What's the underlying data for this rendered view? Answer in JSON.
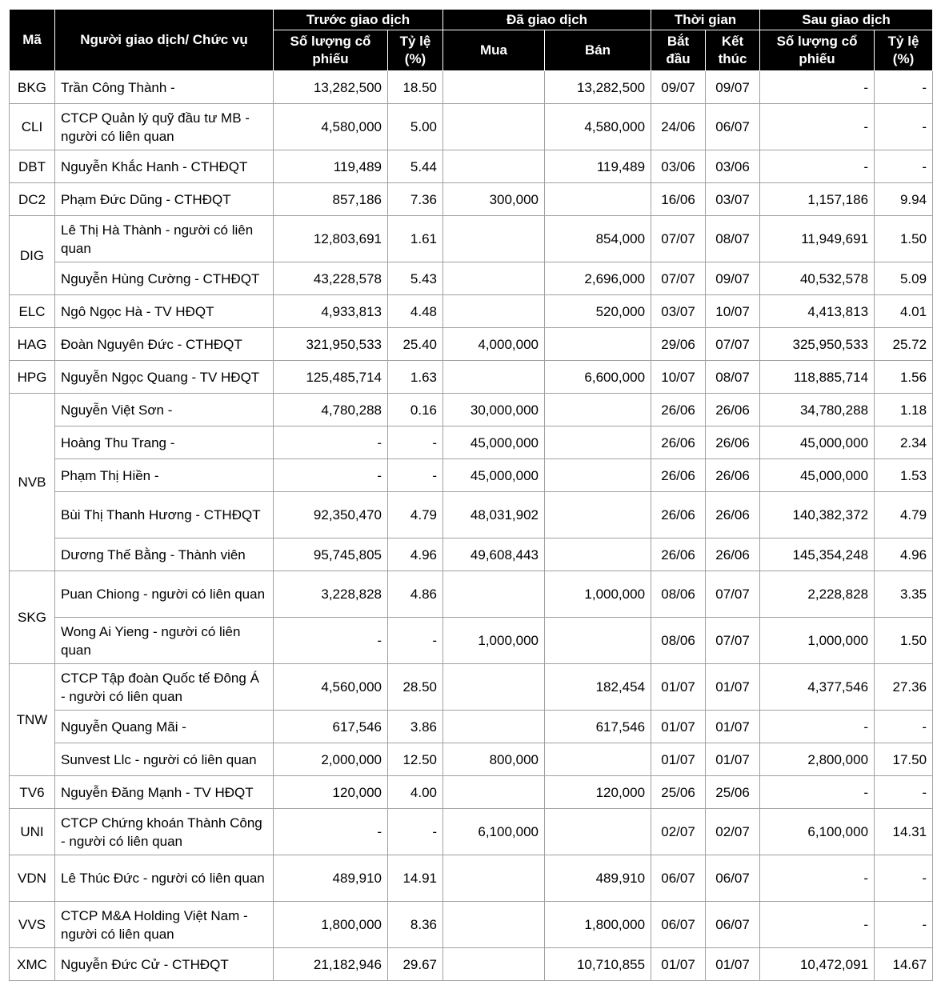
{
  "headers": {
    "ma": "Mã",
    "person": "Người giao dịch/ Chức vụ",
    "before": "Trước giao dịch",
    "traded": "Đã giao dịch",
    "time": "Thời gian",
    "after": "Sau giao dịch",
    "shares": "Số lượng cổ phiếu",
    "ratio": "Tỷ lệ (%)",
    "buy": "Mua",
    "sell": "Bán",
    "start": "Bắt đầu",
    "end": "Kết thúc"
  },
  "rows": [
    {
      "code": "BKG",
      "span": 1,
      "tall": false,
      "name": "Trần Công Thành -",
      "before_shares": "13,282,500",
      "before_ratio": "18.50",
      "buy": "",
      "sell": "13,282,500",
      "start": "09/07",
      "end": "09/07",
      "after_shares": "-",
      "after_ratio": "-"
    },
    {
      "code": "CLI",
      "span": 1,
      "tall": true,
      "name": "CTCP Quản lý quỹ đầu tư MB - người có liên quan",
      "before_shares": "4,580,000",
      "before_ratio": "5.00",
      "buy": "",
      "sell": "4,580,000",
      "start": "24/06",
      "end": "06/07",
      "after_shares": "-",
      "after_ratio": "-"
    },
    {
      "code": "DBT",
      "span": 1,
      "tall": false,
      "name": "Nguyễn Khắc Hanh - CTHĐQT",
      "before_shares": "119,489",
      "before_ratio": "5.44",
      "buy": "",
      "sell": "119,489",
      "start": "03/06",
      "end": "03/06",
      "after_shares": "-",
      "after_ratio": "-"
    },
    {
      "code": "DC2",
      "span": 1,
      "tall": false,
      "name": "Phạm Đức Dũng - CTHĐQT",
      "before_shares": "857,186",
      "before_ratio": "7.36",
      "buy": "300,000",
      "sell": "",
      "start": "16/06",
      "end": "03/07",
      "after_shares": "1,157,186",
      "after_ratio": "9.94"
    },
    {
      "code": "DIG",
      "span": 2,
      "tall": true,
      "name": "Lê Thị Hà Thành - người có liên quan",
      "before_shares": "12,803,691",
      "before_ratio": "1.61",
      "buy": "",
      "sell": "854,000",
      "start": "07/07",
      "end": "08/07",
      "after_shares": "11,949,691",
      "after_ratio": "1.50"
    },
    {
      "code": null,
      "span": 0,
      "tall": false,
      "name": "Nguyễn Hùng Cường - CTHĐQT",
      "before_shares": "43,228,578",
      "before_ratio": "5.43",
      "buy": "",
      "sell": "2,696,000",
      "start": "07/07",
      "end": "09/07",
      "after_shares": "40,532,578",
      "after_ratio": "5.09"
    },
    {
      "code": "ELC",
      "span": 1,
      "tall": false,
      "name": "Ngô Ngọc Hà - TV HĐQT",
      "before_shares": "4,933,813",
      "before_ratio": "4.48",
      "buy": "",
      "sell": "520,000",
      "start": "03/07",
      "end": "10/07",
      "after_shares": "4,413,813",
      "after_ratio": "4.01"
    },
    {
      "code": "HAG",
      "span": 1,
      "tall": false,
      "name": "Đoàn Nguyên Đức - CTHĐQT",
      "before_shares": "321,950,533",
      "before_ratio": "25.40",
      "buy": "4,000,000",
      "sell": "",
      "start": "29/06",
      "end": "07/07",
      "after_shares": "325,950,533",
      "after_ratio": "25.72"
    },
    {
      "code": "HPG",
      "span": 1,
      "tall": false,
      "name": "Nguyễn Ngọc Quang - TV HĐQT",
      "before_shares": "125,485,714",
      "before_ratio": "1.63",
      "buy": "",
      "sell": "6,600,000",
      "start": "10/07",
      "end": "08/07",
      "after_shares": "118,885,714",
      "after_ratio": "1.56"
    },
    {
      "code": "NVB",
      "span": 5,
      "tall": false,
      "name": "Nguyễn Việt Sơn -",
      "before_shares": "4,780,288",
      "before_ratio": "0.16",
      "buy": "30,000,000",
      "sell": "",
      "start": "26/06",
      "end": "26/06",
      "after_shares": "34,780,288",
      "after_ratio": "1.18"
    },
    {
      "code": null,
      "span": 0,
      "tall": false,
      "name": "Hoàng Thu Trang -",
      "before_shares": "-",
      "before_ratio": "-",
      "buy": "45,000,000",
      "sell": "",
      "start": "26/06",
      "end": "26/06",
      "after_shares": "45,000,000",
      "after_ratio": "2.34"
    },
    {
      "code": null,
      "span": 0,
      "tall": false,
      "name": "Phạm Thị Hiền -",
      "before_shares": "-",
      "before_ratio": "-",
      "buy": "45,000,000",
      "sell": "",
      "start": "26/06",
      "end": "26/06",
      "after_shares": "45,000,000",
      "after_ratio": "1.53"
    },
    {
      "code": null,
      "span": 0,
      "tall": true,
      "name": "Bùi Thị Thanh Hương - CTHĐQT",
      "before_shares": "92,350,470",
      "before_ratio": "4.79",
      "buy": "48,031,902",
      "sell": "",
      "start": "26/06",
      "end": "26/06",
      "after_shares": "140,382,372",
      "after_ratio": "4.79"
    },
    {
      "code": null,
      "span": 0,
      "tall": false,
      "name": "Dương Thế Bằng - Thành viên",
      "before_shares": "95,745,805",
      "before_ratio": "4.96",
      "buy": "49,608,443",
      "sell": "",
      "start": "26/06",
      "end": "26/06",
      "after_shares": "145,354,248",
      "after_ratio": "4.96"
    },
    {
      "code": "SKG",
      "span": 2,
      "tall": true,
      "name": "Puan Chiong - người có liên quan",
      "before_shares": "3,228,828",
      "before_ratio": "4.86",
      "buy": "",
      "sell": "1,000,000",
      "start": "08/06",
      "end": "07/07",
      "after_shares": "2,228,828",
      "after_ratio": "3.35"
    },
    {
      "code": null,
      "span": 0,
      "tall": true,
      "name": "Wong Ai Yieng - người có liên quan",
      "before_shares": "-",
      "before_ratio": "-",
      "buy": "1,000,000",
      "sell": "",
      "start": "08/06",
      "end": "07/07",
      "after_shares": "1,000,000",
      "after_ratio": "1.50"
    },
    {
      "code": "TNW",
      "span": 3,
      "tall": true,
      "name": "CTCP Tập đoàn Quốc tế Đông Á - người có liên quan",
      "before_shares": "4,560,000",
      "before_ratio": "28.50",
      "buy": "",
      "sell": "182,454",
      "start": "01/07",
      "end": "01/07",
      "after_shares": "4,377,546",
      "after_ratio": "27.36"
    },
    {
      "code": null,
      "span": 0,
      "tall": false,
      "name": "Nguyễn Quang Mãi -",
      "before_shares": "617,546",
      "before_ratio": "3.86",
      "buy": "",
      "sell": "617,546",
      "start": "01/07",
      "end": "01/07",
      "after_shares": "-",
      "after_ratio": "-"
    },
    {
      "code": null,
      "span": 0,
      "tall": false,
      "name": "Sunvest Llc - người có liên quan",
      "before_shares": "2,000,000",
      "before_ratio": "12.50",
      "buy": "800,000",
      "sell": "",
      "start": "01/07",
      "end": "01/07",
      "after_shares": "2,800,000",
      "after_ratio": "17.50"
    },
    {
      "code": "TV6",
      "span": 1,
      "tall": false,
      "name": "Nguyễn Đăng Mạnh - TV HĐQT",
      "before_shares": "120,000",
      "before_ratio": "4.00",
      "buy": "",
      "sell": "120,000",
      "start": "25/06",
      "end": "25/06",
      "after_shares": "-",
      "after_ratio": "-"
    },
    {
      "code": "UNI",
      "span": 1,
      "tall": true,
      "name": "CTCP Chứng khoán Thành Công - người có liên quan",
      "before_shares": "-",
      "before_ratio": "-",
      "buy": "6,100,000",
      "sell": "",
      "start": "02/07",
      "end": "02/07",
      "after_shares": "6,100,000",
      "after_ratio": "14.31"
    },
    {
      "code": "VDN",
      "span": 1,
      "tall": true,
      "name": "Lê Thúc Đức - người có liên quan",
      "before_shares": "489,910",
      "before_ratio": "14.91",
      "buy": "",
      "sell": "489,910",
      "start": "06/07",
      "end": "06/07",
      "after_shares": "-",
      "after_ratio": "-"
    },
    {
      "code": "VVS",
      "span": 1,
      "tall": true,
      "name": "CTCP M&A Holding Việt Nam - người có liên quan",
      "before_shares": "1,800,000",
      "before_ratio": "8.36",
      "buy": "",
      "sell": "1,800,000",
      "start": "06/07",
      "end": "06/07",
      "after_shares": "-",
      "after_ratio": "-"
    },
    {
      "code": "XMC",
      "span": 1,
      "tall": false,
      "name": "Nguyễn Đức Cử - CTHĐQT",
      "before_shares": "21,182,946",
      "before_ratio": "29.67",
      "buy": "",
      "sell": "10,710,855",
      "start": "01/07",
      "end": "01/07",
      "after_shares": "10,472,091",
      "after_ratio": "14.67"
    }
  ]
}
